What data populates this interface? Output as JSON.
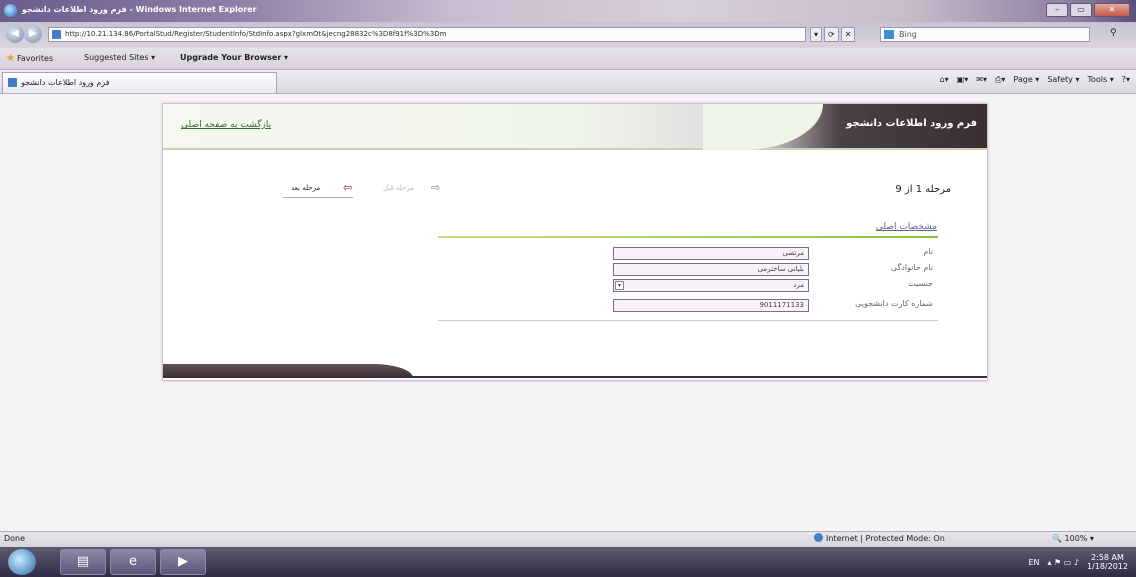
{
  "window": {
    "title": "فرم ورود اطلاعات دانشجو - Windows Internet Explorer",
    "controls": [
      "–",
      "▭",
      "✕"
    ]
  },
  "addressbar": {
    "url": "http://10.21.134.86/PortalStud/Register/StudentInfo/StdInfo.aspx?glxmOt&jecng28832c%3D8f91f%3D%3Dm",
    "buttons": [
      "▾",
      "⟳",
      "✕"
    ],
    "search_placeholder": "Bing"
  },
  "favorites": {
    "favorites_label": "Favorites",
    "suggested_sites": "Suggested Sites ▾",
    "upgrade": "Upgrade Your Browser ▾"
  },
  "tab": {
    "label": "فرم ورود اطلاعات دانشجو"
  },
  "commandbar": {
    "page": "Page ▾",
    "safety": "Safety ▾",
    "tools": "Tools ▾",
    "help": "?▾"
  },
  "form": {
    "title": "فرم ورود اطلاعات دانشجو",
    "back_link": "بازگشت به صفحه اصلی",
    "step_label": "مرحله 1 از 9",
    "prev_label": "مرحله قبل",
    "next_label": "مرحله بعد",
    "section_title": "مشخصات اصلی",
    "fields": [
      {
        "label": "نام",
        "value": "مرتضی"
      },
      {
        "label": "نام خانوادگی",
        "value": "بلیانی ساخترمی"
      },
      {
        "label": "جنسیت",
        "value": "مرد"
      },
      {
        "label": "شماره کارت دانشجویی",
        "value": "9011171133"
      }
    ]
  },
  "statusbar": {
    "status": "Done",
    "zone": "Internet | Protected Mode: On",
    "zoom": "100%"
  },
  "taskbar": {
    "lang": "EN",
    "time": "2:58 AM",
    "date": "1/18/2012"
  }
}
